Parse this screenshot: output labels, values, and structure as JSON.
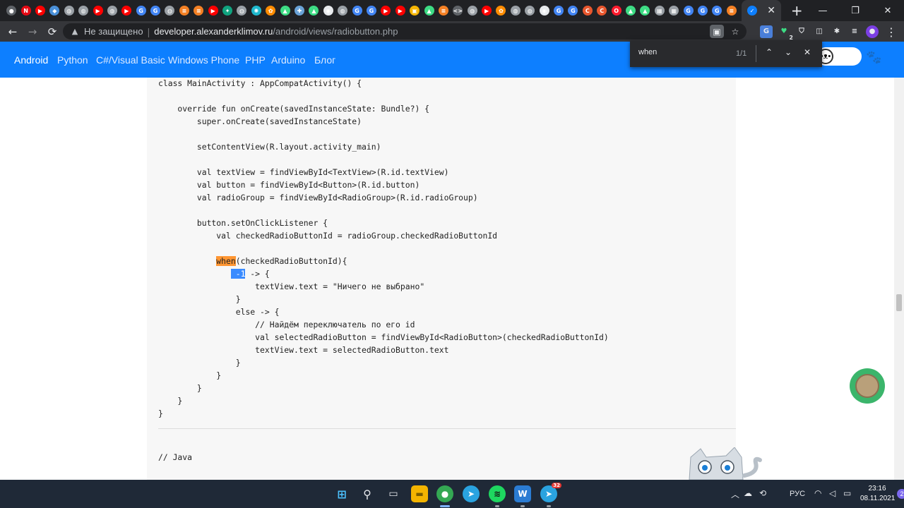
{
  "browser": {
    "tabs": [
      {
        "icon": "tab-icon",
        "color": "#5f6368"
      },
      {
        "icon": "netflix-icon",
        "color": "#e50914"
      },
      {
        "icon": "youtube-icon",
        "color": "#ff0000"
      },
      {
        "icon": "bird-icon",
        "color": "#4a90d9"
      },
      {
        "icon": "globe-icon",
        "color": "#9aa0a6"
      },
      {
        "icon": "globe-icon",
        "color": "#9aa0a6"
      },
      {
        "icon": "youtube-icon",
        "color": "#ff0000"
      },
      {
        "icon": "globe-icon",
        "color": "#9aa0a6"
      },
      {
        "icon": "youtube-icon",
        "color": "#ff0000"
      },
      {
        "icon": "google-icon",
        "color": "#4285f4"
      },
      {
        "icon": "google-icon",
        "color": "#4285f4"
      },
      {
        "icon": "globe-icon",
        "color": "#9aa0a6"
      },
      {
        "icon": "stack-icon",
        "color": "#f48024"
      },
      {
        "icon": "stack-icon",
        "color": "#f48024"
      },
      {
        "icon": "youtube-icon",
        "color": "#ff0000"
      },
      {
        "icon": "chatgpt-icon",
        "color": "#10a37f"
      },
      {
        "icon": "globe-icon",
        "color": "#9aa0a6"
      },
      {
        "icon": "openai-icon",
        "color": "#1fb8cd"
      },
      {
        "icon": "paw-icon",
        "color": "#ff8c00"
      },
      {
        "icon": "android-icon",
        "color": "#3ddc84"
      },
      {
        "icon": "chip-icon",
        "color": "#6aa3d8"
      },
      {
        "icon": "android-icon",
        "color": "#3ddc84"
      },
      {
        "icon": "github-icon",
        "color": "#e8eaed"
      },
      {
        "icon": "globe-icon",
        "color": "#9aa0a6"
      },
      {
        "icon": "google-icon",
        "color": "#4285f4"
      },
      {
        "icon": "google-icon",
        "color": "#4285f4"
      },
      {
        "icon": "youtube-icon",
        "color": "#ff0000"
      },
      {
        "icon": "youtube-icon",
        "color": "#ff0000"
      },
      {
        "icon": "image-icon",
        "color": "#f4b400"
      },
      {
        "icon": "android-icon",
        "color": "#3ddc84"
      },
      {
        "icon": "stack-icon",
        "color": "#f48024"
      },
      {
        "icon": "code-icon",
        "color": "#5f6368"
      },
      {
        "icon": "globe-icon",
        "color": "#9aa0a6"
      },
      {
        "icon": "youtube-icon",
        "color": "#ff0000"
      },
      {
        "icon": "paw-icon",
        "color": "#ff8c00"
      },
      {
        "icon": "globe-icon",
        "color": "#9aa0a6"
      },
      {
        "icon": "globe-icon",
        "color": "#9aa0a6"
      },
      {
        "icon": "github-icon",
        "color": "#e8eaed"
      },
      {
        "icon": "google-icon",
        "color": "#4285f4"
      },
      {
        "icon": "google-icon",
        "color": "#4285f4"
      },
      {
        "icon": "coursera-icon",
        "color": "#e8572e"
      },
      {
        "icon": "coursera-icon",
        "color": "#e8572e"
      },
      {
        "icon": "opera-icon",
        "color": "#ff1b2d"
      },
      {
        "icon": "android-icon",
        "color": "#3ddc84"
      },
      {
        "icon": "android-icon",
        "color": "#3ddc84"
      },
      {
        "icon": "grid-icon",
        "color": "#9aa0a6"
      },
      {
        "icon": "grid-icon",
        "color": "#9aa0a6"
      },
      {
        "icon": "google-icon",
        "color": "#4285f4"
      },
      {
        "icon": "google-icon",
        "color": "#4285f4"
      },
      {
        "icon": "google-icon",
        "color": "#4285f4"
      },
      {
        "icon": "stack-icon",
        "color": "#f48024"
      }
    ],
    "active_tab_close": "✕",
    "new_tab": "+",
    "window_controls": {
      "minimize": "—",
      "maximize": "❐",
      "close": "✕"
    },
    "back": "←",
    "forward": "→",
    "reload": "⟳",
    "security_warning": "▲",
    "security_text": "Не защищено",
    "separator": "|",
    "url_domain": "developer.alexanderklimov.ru",
    "url_path": "/android/views/radiobutton.php",
    "bookmark_star": "☆",
    "extensions_count": "2"
  },
  "find": {
    "query": "when",
    "count": "1/1",
    "prev": "⌃",
    "next": "⌄",
    "close": "✕"
  },
  "site_nav": {
    "items": [
      "Android",
      "Python",
      "C#/Visual Basic",
      "Windows Phone",
      "PHP",
      "Arduino",
      "Блог"
    ],
    "active_index": 0
  },
  "code": {
    "lines": [
      "class MainActivity : AppCompatActivity() {",
      "",
      "    override fun onCreate(savedInstanceState: Bundle?) {",
      "        super.onCreate(savedInstanceState)",
      "",
      "        setContentView(R.layout.activity_main)",
      "",
      "        val textView = findViewById<TextView>(R.id.textView)",
      "        val button = findViewById<Button>(R.id.button)",
      "        val radioGroup = findViewById<RadioGroup>(R.id.radioGroup)",
      "",
      "        button.setOnClickListener {",
      "            val checkedRadioButtonId = radioGroup.checkedRadioButtonId",
      "",
      "            when(checkedRadioButtonId){",
      "                -1 -> {",
      "                    textView.text = \"Ничего не выбрано\"",
      "                }",
      "                else -> {",
      "                    // Найдём переключатель по его id",
      "                    val selectedRadioButton = findViewById<RadioButton>(checkedRadioButtonId)",
      "                    textView.text = selectedRadioButton.text",
      "                }",
      "            }",
      "        }",
      "    }",
      "}"
    ],
    "java_comment": "// Java"
  },
  "taskbar": {
    "telegram_badge": "32",
    "language": "РУС",
    "time": "23:16",
    "date": "08.11.2021",
    "notifications": "2"
  },
  "colors": {
    "site_header": "#0d7fff",
    "find_highlight": "#ff9632",
    "selection_highlight": "#3a8bff"
  }
}
